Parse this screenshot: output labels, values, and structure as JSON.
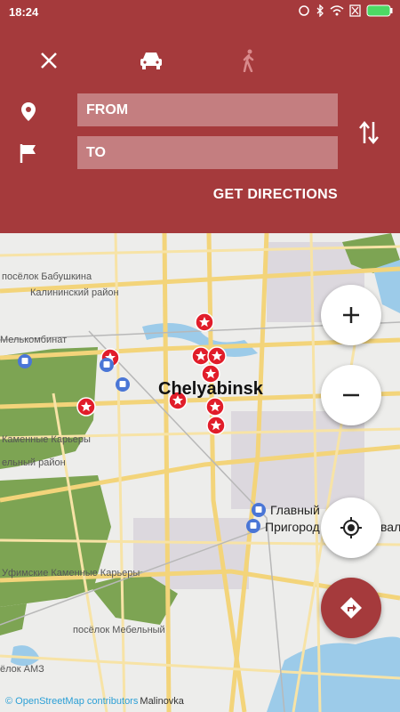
{
  "status": {
    "time": "18:24"
  },
  "header": {
    "from_label": "FROM",
    "to_label": "TO",
    "get_directions": "GET DIRECTIONS"
  },
  "map": {
    "city": "Chelyabinsk",
    "labels": [
      "посёлок Бабушкина",
      "Калининский район",
      "Мелькомбинат",
      "Каменные Карьеры",
      "ельный район",
      "Уфимские Каменные Карьеры",
      "посёлок Мебельный",
      "ёлок АМЗ"
    ],
    "station_labels": [
      "Главный",
      "Пригород",
      "вал"
    ],
    "attribution": "© OpenStreetMap contributors",
    "district": "Malinovka"
  },
  "colors": {
    "accent": "#a53a3c",
    "park": "#7da453",
    "water": "#9ccbe9",
    "road": "#f3d47a"
  }
}
